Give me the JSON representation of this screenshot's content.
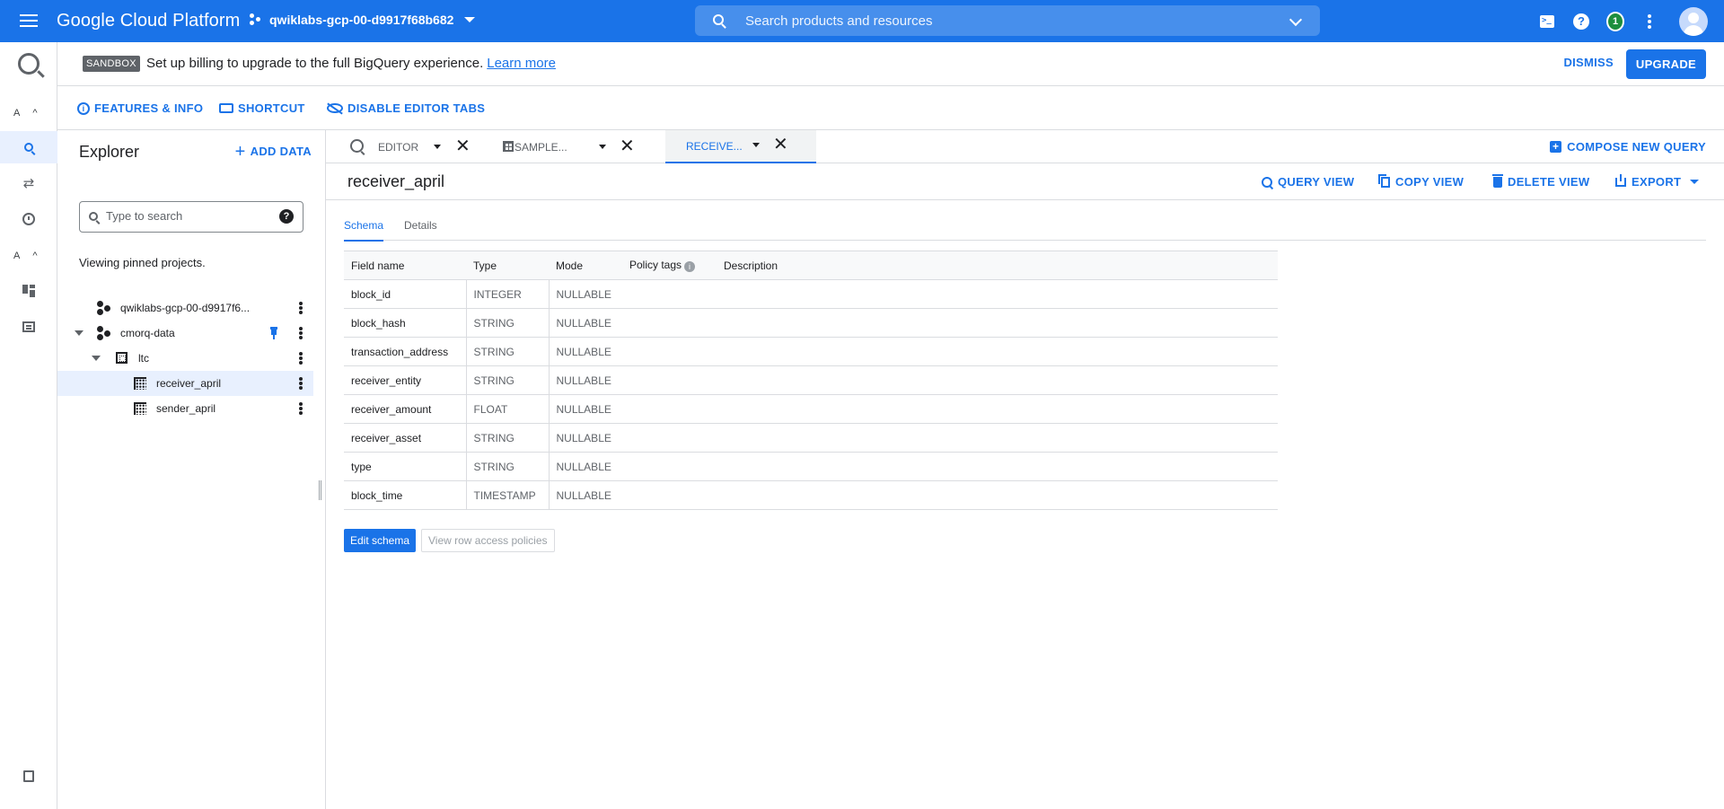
{
  "topbar": {
    "brand": "Google Cloud Platform",
    "project": "qwiklabs-gcp-00-d9917f68b682",
    "search_placeholder": "Search products and resources",
    "notification_count": "1"
  },
  "rail": {
    "section_a_label": "A",
    "section_b_label": "A"
  },
  "banner": {
    "badge": "SANDBOX",
    "text": "Set up billing to upgrade to the full BigQuery experience.",
    "link": "Learn more",
    "dismiss": "DISMISS",
    "upgrade": "UPGRADE"
  },
  "actionbar": {
    "features": "FEATURES & INFO",
    "shortcut": "SHORTCUT",
    "disable_tabs": "DISABLE EDITOR TABS"
  },
  "explorer": {
    "title": "Explorer",
    "add_data": "ADD DATA",
    "search_placeholder": "Type to search",
    "pinned_note": "Viewing pinned projects.",
    "tree": {
      "project1": "qwiklabs-gcp-00-d9917f6...",
      "project2": "cmorq-data",
      "dataset": "ltc",
      "table1": "receiver_april",
      "table2": "sender_april"
    }
  },
  "tabs": {
    "editor": "EDITOR",
    "sample": "SAMPLE...",
    "receive": "RECEIVE...",
    "compose": "COMPOSE NEW QUERY"
  },
  "resource": {
    "title": "receiver_april",
    "query_view": "QUERY VIEW",
    "copy_view": "COPY VIEW",
    "delete_view": "DELETE VIEW",
    "export": "EXPORT"
  },
  "subtabs": {
    "schema": "Schema",
    "details": "Details"
  },
  "schema": {
    "headers": [
      "Field name",
      "Type",
      "Mode",
      "Policy tags",
      "Description"
    ],
    "rows": [
      {
        "name": "block_id",
        "type": "INTEGER",
        "mode": "NULLABLE"
      },
      {
        "name": "block_hash",
        "type": "STRING",
        "mode": "NULLABLE"
      },
      {
        "name": "transaction_address",
        "type": "STRING",
        "mode": "NULLABLE"
      },
      {
        "name": "receiver_entity",
        "type": "STRING",
        "mode": "NULLABLE"
      },
      {
        "name": "receiver_amount",
        "type": "FLOAT",
        "mode": "NULLABLE"
      },
      {
        "name": "receiver_asset",
        "type": "STRING",
        "mode": "NULLABLE"
      },
      {
        "name": "type",
        "type": "STRING",
        "mode": "NULLABLE"
      },
      {
        "name": "block_time",
        "type": "TIMESTAMP",
        "mode": "NULLABLE"
      }
    ]
  },
  "buttons": {
    "edit_schema": "Edit schema",
    "row_policies": "View row access policies"
  }
}
